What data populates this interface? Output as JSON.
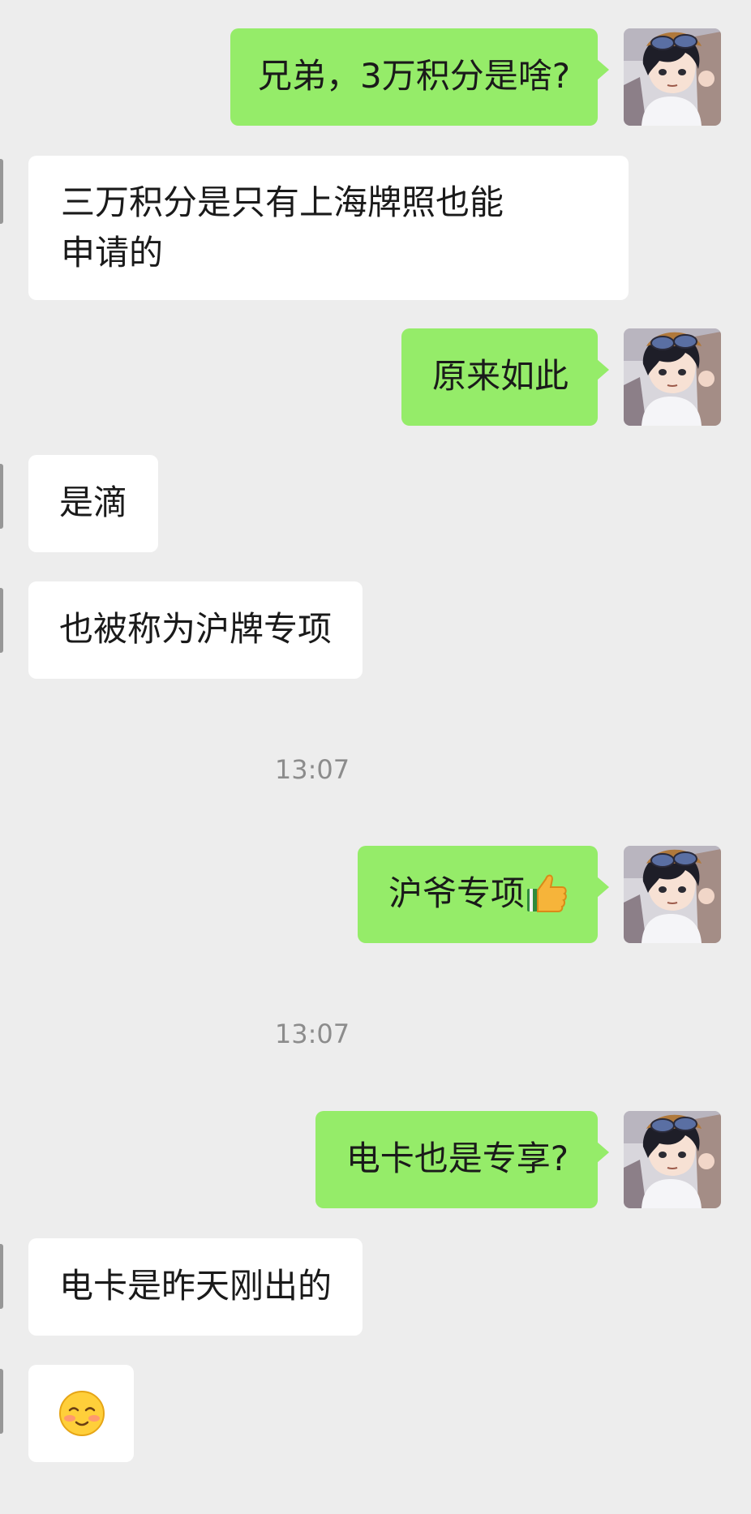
{
  "messages": [
    {
      "side": "out",
      "text": "兄弟，3万积分是啥?"
    },
    {
      "side": "in",
      "line1": "三万积分是只有上海牌照也能",
      "line2": "申请的"
    },
    {
      "side": "out",
      "text": "原来如此"
    },
    {
      "side": "in",
      "text": "是滴"
    },
    {
      "side": "in",
      "text": "也被称为沪牌专项"
    },
    {
      "time": "13:07"
    },
    {
      "side": "out",
      "text": "沪爷专项",
      "emoji": "thumbs-up-icon"
    },
    {
      "time": "13:07"
    },
    {
      "side": "out",
      "text": "电卡也是专享?"
    },
    {
      "side": "in",
      "text": "电卡是昨天刚出的"
    },
    {
      "side": "in",
      "emoji": "blushing-smile-icon"
    }
  ],
  "colors": {
    "background": "#ededed",
    "outgoing_bubble": "#95ec69",
    "incoming_bubble": "#ffffff",
    "timestamp_text": "#8c8c8c"
  },
  "avatar": {
    "icon": "anime-boy-avatar-icon"
  }
}
